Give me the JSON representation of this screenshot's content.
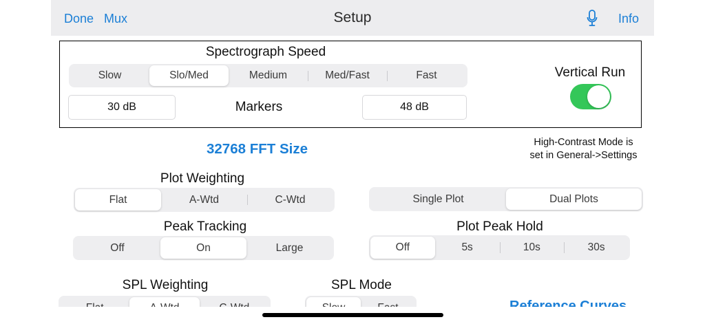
{
  "nav": {
    "done": "Done",
    "mux": "Mux",
    "title": "Setup",
    "info": "Info",
    "mic_icon": "microphone-icon"
  },
  "spectrograph": {
    "title": "Spectrograph Speed",
    "options": [
      "Slow",
      "Slo/Med",
      "Medium",
      "Med/Fast",
      "Fast"
    ],
    "selected": "Slo/Med",
    "markers_label": "Markers",
    "marker_low": "30 dB",
    "marker_high": "48 dB",
    "vertical_run_label": "Vertical Run",
    "vertical_run_on": true
  },
  "fft_size": "32768 FFT Size",
  "contrast_note_line1": "High-Contrast Mode is",
  "contrast_note_line2": "set in General->Settings",
  "plot_weighting": {
    "title": "Plot Weighting",
    "options": [
      "Flat",
      "A-Wtd",
      "C-Wtd"
    ],
    "selected": "Flat"
  },
  "plot_count": {
    "options": [
      "Single Plot",
      "Dual Plots"
    ],
    "selected": "Dual Plots"
  },
  "peak_tracking": {
    "title": "Peak Tracking",
    "options": [
      "Off",
      "On",
      "Large"
    ],
    "selected": "On"
  },
  "plot_peak_hold": {
    "title": "Plot Peak Hold",
    "options": [
      "Off",
      "5s",
      "10s",
      "30s"
    ],
    "selected": "Off"
  },
  "spl_weighting": {
    "title": "SPL Weighting",
    "options": [
      "Flat",
      "A-Wtd",
      "C-Wtd"
    ],
    "selected": "A-Wtd"
  },
  "spl_mode": {
    "title": "SPL Mode",
    "options": [
      "Slow",
      "Fast"
    ],
    "selected": "Slow"
  },
  "reference_curves": "Reference Curves"
}
